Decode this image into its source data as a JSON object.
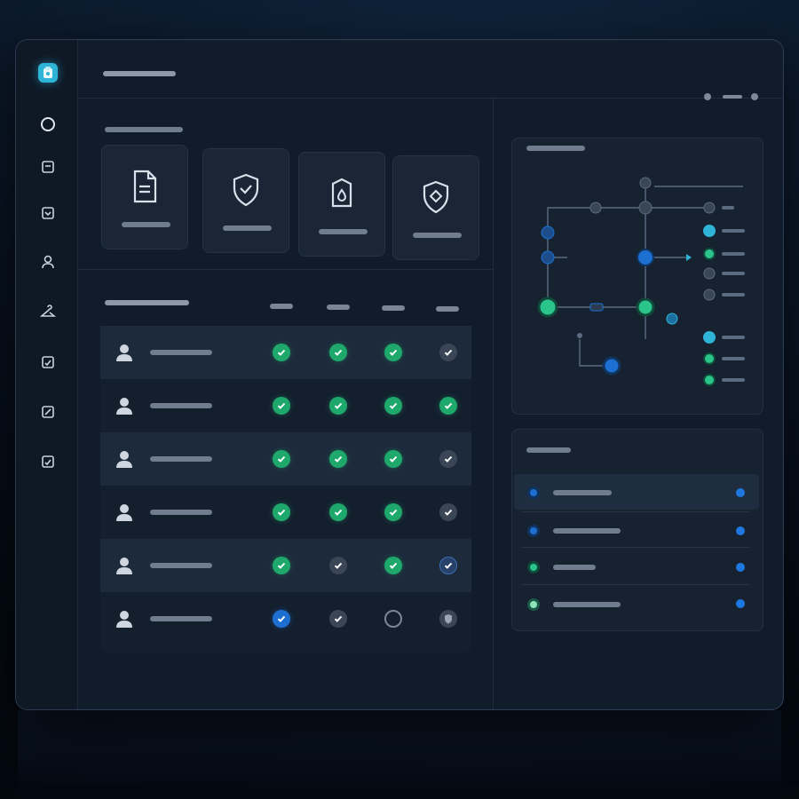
{
  "theme": {
    "accent": "#2db4d6",
    "success": "#1fa86b",
    "primary": "#1d6fd1",
    "background": "#111c2b"
  },
  "sidebar": {
    "logo_icon": "app-logo-icon",
    "items": [
      {
        "icon": "circle-icon"
      },
      {
        "icon": "folder-icon"
      },
      {
        "icon": "download-icon"
      },
      {
        "icon": "users-icon"
      },
      {
        "icon": "hanger-icon"
      },
      {
        "icon": "checkbox-icon"
      },
      {
        "icon": "edit-icon"
      },
      {
        "icon": "checkbox-icon"
      }
    ]
  },
  "categories": [
    {
      "icon": "document-icon"
    },
    {
      "icon": "shield-check-icon"
    },
    {
      "icon": "lock-drop-icon"
    },
    {
      "icon": "shield-diamond-icon"
    }
  ],
  "permissions_table": {
    "column_count": 4,
    "rows": [
      {
        "checks": [
          "on",
          "on",
          "on",
          "muted"
        ]
      },
      {
        "checks": [
          "on",
          "on",
          "on",
          "on"
        ]
      },
      {
        "checks": [
          "on",
          "on",
          "on",
          "muted"
        ]
      },
      {
        "checks": [
          "on",
          "on",
          "on",
          "muted"
        ]
      },
      {
        "checks": [
          "on",
          "muted",
          "on",
          "blue-dim"
        ]
      },
      {
        "checks": [
          "blue",
          "muted",
          "empty",
          "shield"
        ]
      }
    ]
  },
  "list_panel": {
    "items": [
      {
        "status": "blue"
      },
      {
        "status": "blue"
      },
      {
        "status": "green"
      },
      {
        "status": "green-light"
      }
    ]
  }
}
